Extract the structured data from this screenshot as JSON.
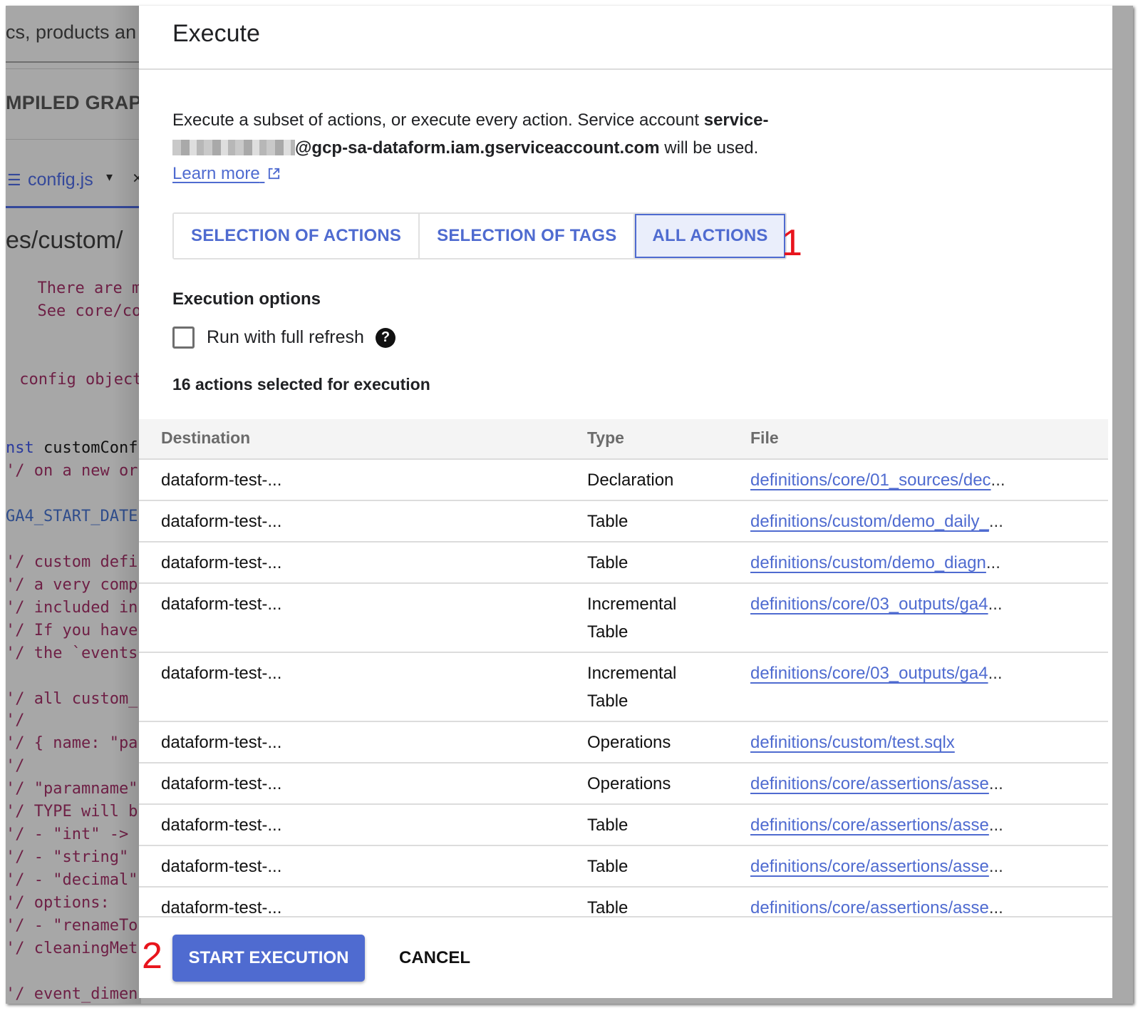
{
  "background": {
    "top_text": "cs, products an",
    "tab_text": "MPILED GRAPH",
    "file_tab": {
      "icon": "list-icon",
      "name": "config.js",
      "caret": "▾",
      "close": "×"
    },
    "path": "es/custom/",
    "code_lines": [
      "  There are mo",
      "  See core/cor",
      "",
      "",
      " config object",
      "",
      "",
      "nst customConf",
      "'/ on a new or",
      "",
      "GA4_START_DATE",
      "",
      "'/ custom defi",
      "'/ a very comp",
      "'/ included in",
      "'/ If you have",
      "'/ the `events",
      "",
      "'/ all custom_",
      "'/",
      "'/ { name: \"pa",
      "'/",
      "'/ \"paramname\"",
      "'/ TYPE will b",
      "'/ - \"int\" ->",
      "'/ - \"string\"",
      "'/ - \"decimal\"",
      "'/ options:",
      "'/ - \"renameTo",
      "'/ cleaningMet",
      "",
      "'/ event_dimen"
    ]
  },
  "dialog": {
    "title": "Execute",
    "description": {
      "prefix": "Execute a subset of actions, or execute every action. Service account ",
      "account_start": "service-",
      "account_domain": "@gcp-sa-dataform.iam.gserviceaccount.com",
      "suffix": " will be used."
    },
    "learn_more": "Learn more",
    "modes": [
      {
        "label": "SELECTION OF ACTIONS",
        "active": false
      },
      {
        "label": "SELECTION OF TAGS",
        "active": false
      },
      {
        "label": "ALL ACTIONS",
        "active": true
      }
    ],
    "annotations": {
      "first": "1",
      "second": "2"
    },
    "execution_options_label": "Execution options",
    "full_refresh": {
      "label": "Run with full refresh",
      "checked": false
    },
    "selected_count_text": "16 actions selected for execution",
    "table": {
      "headers": {
        "destination": "Destination",
        "type": "Type",
        "file": "File"
      },
      "rows": [
        {
          "destination": "dataform-test-...",
          "type": "Declaration",
          "file": "definitions/core/01_sources/dec",
          "truncated": true
        },
        {
          "destination": "dataform-test-...",
          "type": "Table",
          "file": "definitions/custom/demo_daily_",
          "truncated": true
        },
        {
          "destination": "dataform-test-...",
          "type": "Table",
          "file": "definitions/custom/demo_diagn",
          "truncated": true
        },
        {
          "destination": "dataform-test-...",
          "type": "Incremental Table",
          "file": "definitions/core/03_outputs/ga4",
          "truncated": true
        },
        {
          "destination": "dataform-test-...",
          "type": "Incremental Table",
          "file": "definitions/core/03_outputs/ga4",
          "truncated": true
        },
        {
          "destination": "dataform-test-...",
          "type": "Operations",
          "file": "definitions/custom/test.sqlx",
          "truncated": false
        },
        {
          "destination": "dataform-test-...",
          "type": "Operations",
          "file": "definitions/core/assertions/asse",
          "truncated": true
        },
        {
          "destination": "dataform-test-...",
          "type": "Table",
          "file": "definitions/core/assertions/asse",
          "truncated": true
        },
        {
          "destination": "dataform-test-...",
          "type": "Table",
          "file": "definitions/core/assertions/asse",
          "truncated": true
        },
        {
          "destination": "dataform-test-...",
          "type": "Table",
          "file": "definitions/core/assertions/asse",
          "truncated": true
        }
      ],
      "ellipsis": "..."
    },
    "buttons": {
      "start": "START EXECUTION",
      "cancel": "CANCEL"
    }
  },
  "colors": {
    "accent": "#4f6bd0",
    "annotation": "#e8141c",
    "active_tab_bg": "#eaeefb"
  }
}
